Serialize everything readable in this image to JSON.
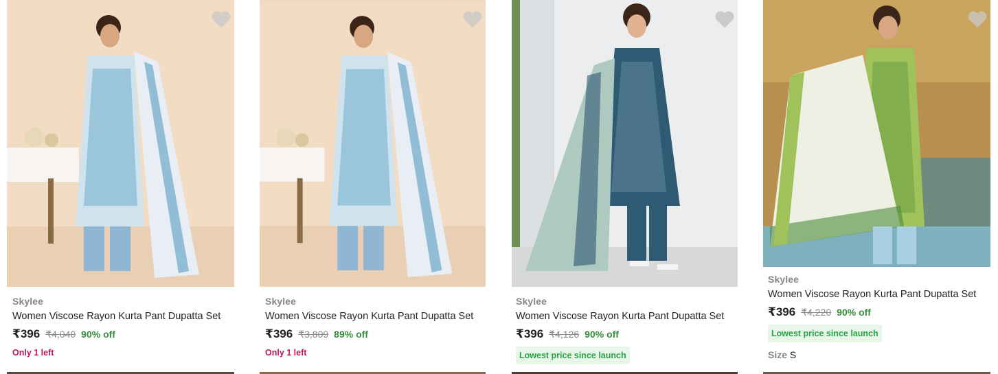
{
  "products": [
    {
      "brand": "Skylee",
      "title": "Women Viscose Rayon Kurta Pant Dupatta Set",
      "price": "₹396",
      "mrp": "₹4,040",
      "discount": "90% off",
      "note": "Only 1 left",
      "image": {
        "bg": "#f0d6bc",
        "kurta": "#cfe3ef",
        "print": "#3a8bb7",
        "dupatta": "#e9eef4",
        "pants": "#8fb7d4"
      }
    },
    {
      "brand": "Skylee",
      "title": "Women Viscose Rayon Kurta Pant Dupatta Set",
      "price": "₹396",
      "mrp": "₹3,809",
      "discount": "89% off",
      "note": "Only 1 left",
      "image": {
        "bg": "#f0d6bc",
        "kurta": "#cfe3ef",
        "print": "#3a8bb7",
        "dupatta": "#e9eef4",
        "pants": "#8fb7d4"
      }
    },
    {
      "brand": "Skylee",
      "title": "Women Viscose Rayon Kurta Pant Dupatta Set",
      "price": "₹396",
      "mrp": "₹4,126",
      "discount": "90% off",
      "badge": "Lowest price since launch",
      "image": {
        "bg": "#e7e9ea",
        "kurta": "#2f5a73",
        "print": "#8fb2c6",
        "dupatta": "#aec9bf",
        "pants": "#2f5a73"
      }
    },
    {
      "brand": "Skylee",
      "title": "Women Viscose Rayon Kurta Pant Dupatta Set",
      "price": "₹396",
      "mrp": "₹4,220",
      "discount": "90% off",
      "badge": "Lowest price since launch",
      "size_label": "Size",
      "size_value": "S",
      "image": {
        "bg": "#b58a4e",
        "kurta": "#9fc25a",
        "print": "#4d8a3a",
        "dupatta": "#eef0e4",
        "pants": "#a9cfe0"
      }
    }
  ],
  "colors": {
    "discount": "#388e3c",
    "stock": "#c2185b",
    "badge_bg": "#e8f5e9",
    "badge_text": "#26a541"
  },
  "icons": {
    "wishlist": "heart-icon"
  }
}
